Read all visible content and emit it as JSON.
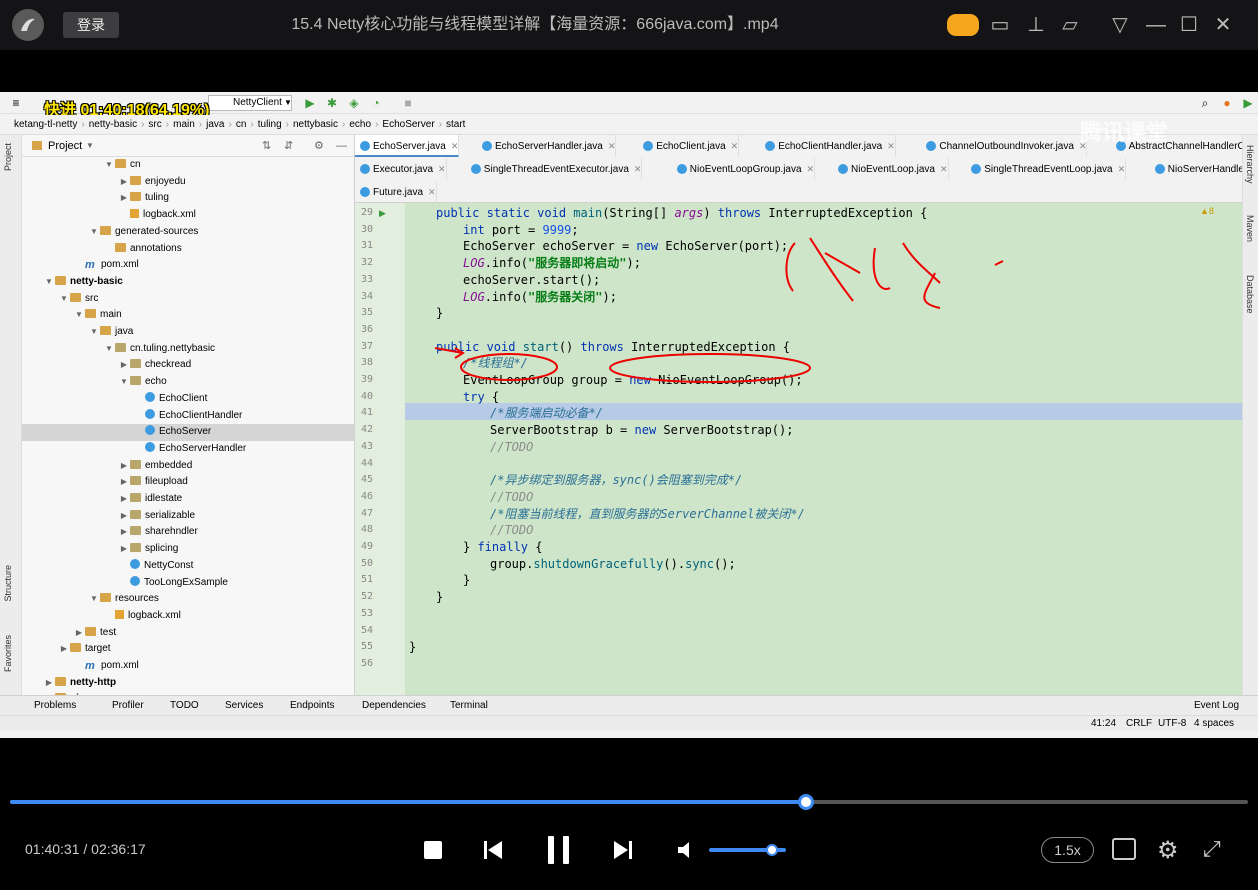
{
  "player": {
    "login_label": "登录",
    "video_title": "15.4 Netty核心功能与线程模型详解【海量资源：666java.com】.mp4",
    "current_time": "01:40:31",
    "duration": "02:36:17",
    "progress_fraction": 0.6432,
    "volume_fraction": 0.85,
    "speed_label": "1.5x",
    "accent_color": "#3d8bf2",
    "watermark": "腾讯课堂"
  },
  "overlay": {
    "progress_badge": "快进 01:40:18(64.19%)"
  },
  "ide": {
    "run_config": "NettyClient",
    "breadcrumb": [
      "ketang-tl-netty",
      "netty-basic",
      "src",
      "main",
      "java",
      "cn",
      "tuling",
      "nettybasic",
      "echo",
      "EchoServer",
      "start"
    ],
    "project_label": "Project",
    "left_stripe": [
      "Project",
      "Structure",
      "Favorites"
    ],
    "right_stripe": [
      "Hierarchy",
      "Maven",
      "Database"
    ],
    "tree": [
      {
        "label": "cn",
        "depth": 5,
        "icon": "folder",
        "arrow": "down"
      },
      {
        "label": "enjoyedu",
        "depth": 6,
        "icon": "folder",
        "arrow": "right"
      },
      {
        "label": "tuling",
        "depth": 6,
        "icon": "folder",
        "arrow": "right"
      },
      {
        "label": "logback.xml",
        "depth": 6,
        "icon": "xml",
        "arrow": ""
      },
      {
        "label": "generated-sources",
        "depth": 4,
        "icon": "folder",
        "arrow": "down"
      },
      {
        "label": "annotations",
        "depth": 5,
        "icon": "folder",
        "arrow": ""
      },
      {
        "label": "pom.xml",
        "depth": 3,
        "icon": "mvn",
        "arrow": ""
      },
      {
        "label": "netty-basic",
        "depth": 1,
        "icon": "folder",
        "arrow": "down",
        "bold": true
      },
      {
        "label": "src",
        "depth": 2,
        "icon": "folder",
        "arrow": "down"
      },
      {
        "label": "main",
        "depth": 3,
        "icon": "folder",
        "arrow": "down"
      },
      {
        "label": "java",
        "depth": 4,
        "icon": "folder",
        "arrow": "down"
      },
      {
        "label": "cn.tuling.nettybasic",
        "depth": 5,
        "icon": "pkg",
        "arrow": "down"
      },
      {
        "label": "checkread",
        "depth": 6,
        "icon": "pkg",
        "arrow": "right"
      },
      {
        "label": "echo",
        "depth": 6,
        "icon": "pkg",
        "arrow": "down"
      },
      {
        "label": "EchoClient",
        "depth": 7,
        "icon": "cls",
        "arrow": ""
      },
      {
        "label": "EchoClientHandler",
        "depth": 7,
        "icon": "cls",
        "arrow": ""
      },
      {
        "label": "EchoServer",
        "depth": 7,
        "icon": "cls",
        "arrow": "",
        "selected": true
      },
      {
        "label": "EchoServerHandler",
        "depth": 7,
        "icon": "cls",
        "arrow": ""
      },
      {
        "label": "embedded",
        "depth": 6,
        "icon": "pkg",
        "arrow": "right"
      },
      {
        "label": "fileupload",
        "depth": 6,
        "icon": "pkg",
        "arrow": "right"
      },
      {
        "label": "idlestate",
        "depth": 6,
        "icon": "pkg",
        "arrow": "right"
      },
      {
        "label": "serializable",
        "depth": 6,
        "icon": "pkg",
        "arrow": "right"
      },
      {
        "label": "sharehndler",
        "depth": 6,
        "icon": "pkg",
        "arrow": "right"
      },
      {
        "label": "splicing",
        "depth": 6,
        "icon": "pkg",
        "arrow": "right"
      },
      {
        "label": "NettyConst",
        "depth": 6,
        "icon": "cls",
        "arrow": ""
      },
      {
        "label": "TooLongExSample",
        "depth": 6,
        "icon": "cls",
        "arrow": ""
      },
      {
        "label": "resources",
        "depth": 4,
        "icon": "folder",
        "arrow": "down"
      },
      {
        "label": "logback.xml",
        "depth": 5,
        "icon": "xml",
        "arrow": ""
      },
      {
        "label": "test",
        "depth": 3,
        "icon": "folder",
        "arrow": "right"
      },
      {
        "label": "target",
        "depth": 2,
        "icon": "folder",
        "arrow": "right"
      },
      {
        "label": "pom.xml",
        "depth": 3,
        "icon": "mvn",
        "arrow": ""
      },
      {
        "label": "netty-http",
        "depth": 1,
        "icon": "folder",
        "arrow": "right",
        "bold": true
      },
      {
        "label": "nio",
        "depth": 1,
        "icon": "folder",
        "arrow": "right",
        "bold": true
      }
    ],
    "tabs_row1": [
      "EchoServer.java",
      "EchoServerHandler.java",
      "EchoClient.java",
      "EchoClientHandler.java",
      "ChannelOutboundInvoker.java",
      "AbstractChannelHandlerContext.java"
    ],
    "tabs_row2": [
      "Executor.java",
      "SingleThreadEventExecutor.java",
      "NioEventLoopGroup.java",
      "NioEventLoop.java",
      "SingleThreadEventLoop.java",
      "NioServerHandle.java"
    ],
    "tabs_row3": [
      "Future.java"
    ],
    "warning_count": "8",
    "line_numbers": [
      "29",
      "30",
      "31",
      "32",
      "33",
      "34",
      "35",
      "36",
      "37",
      "38",
      "39",
      "40",
      "41",
      "42",
      "43",
      "44",
      "45",
      "46",
      "47",
      "48",
      "49",
      "50",
      "51",
      "52",
      "53",
      "54",
      "55",
      "56"
    ],
    "code": {
      "l29a": "public static void ",
      "l29b": "main",
      "l29c": "(String[] ",
      "l29d": "args",
      "l29e": ") ",
      "l29f": "throws ",
      "l29g": "InterruptedException {",
      "l30a": "int ",
      "l30b": "port",
      "l30c": " = ",
      "l30d": "9999",
      "l30e": ";",
      "l31a": "EchoServer ",
      "l31b": "echoServer",
      "l31c": " = ",
      "l31d": "new ",
      "l31e": "EchoServer(port);",
      "l32a": "LOG",
      "l32b": ".info(",
      "l32c": "\"服务器即将启动\"",
      "l32d": ");",
      "l33a": "echoServer.start();",
      "l34a": "LOG",
      "l34b": ".info(",
      "l34c": "\"服务器关闭\"",
      "l34d": ");",
      "l35a": "}",
      "l37a": "public void ",
      "l37b": "start",
      "l37c": "() ",
      "l37d": "throws ",
      "l37e": "InterruptedException {",
      "l38a": "/*线程组*/",
      "l39a": "EventLoopGroup ",
      "l39b": "group",
      "l39c": " = ",
      "l39d": "new ",
      "l39e": "NioEventLoopGroup();",
      "l40a": "try ",
      "l40b": "{",
      "l41a": "/*服务端启动必备*/",
      "l42a": "ServerBootstrap ",
      "l42b": "b",
      "l42c": " = ",
      "l42d": "new ",
      "l42e": "ServerBootstrap();",
      "l43a": "//TODO",
      "l45a": "/*异步绑定到服务器，sync()会阻塞到完成*/",
      "l46a": "//TODO",
      "l47a": "/*阻塞当前线程，直到服务器的ServerChannel被关闭*/",
      "l48a": "//TODO",
      "l49a": "} ",
      "l49b": "finally ",
      "l49c": "{",
      "l50a": "group.",
      "l50b": "shutdownGracefully",
      "l50c": "().",
      "l50d": "sync",
      "l50e": "();",
      "l51a": "}",
      "l52a": "}",
      "l55a": "}"
    },
    "toolwindows": [
      "Problems",
      "Profiler",
      "TODO",
      "Services",
      "Endpoints",
      "Dependencies",
      "Terminal"
    ],
    "event_log": "Event Log",
    "status": {
      "position": "41:24",
      "line_sep": "CRLF",
      "encoding": "UTF-8",
      "indent": "4 spaces"
    }
  }
}
